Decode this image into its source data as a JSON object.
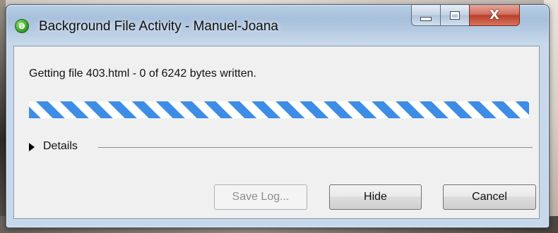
{
  "window": {
    "title": "Background File Activity - Manuel-Joana",
    "app_icon": "dreamweaver-icon",
    "controls": {
      "minimize": "minimize-icon",
      "maximize": "maximize-icon",
      "close_glyph": "X"
    }
  },
  "status_text": "Getting file 403.html - 0 of 6242 bytes written.",
  "progress": {
    "mode": "indeterminate",
    "color": "#3d8de6"
  },
  "details": {
    "label": "Details",
    "expanded": false
  },
  "buttons": {
    "save_log": {
      "label": "Save Log...",
      "enabled": false
    },
    "hide": {
      "label": "Hide",
      "enabled": true
    },
    "cancel": {
      "label": "Cancel",
      "enabled": true
    }
  }
}
